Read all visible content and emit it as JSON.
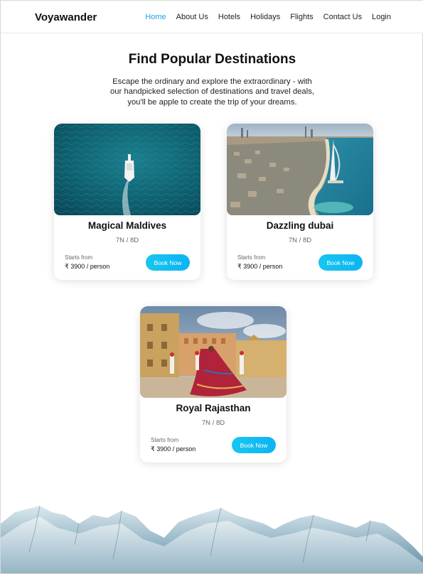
{
  "nav": {
    "brand": "Voyawander",
    "links": [
      {
        "label": "Home",
        "active": true
      },
      {
        "label": "About Us"
      },
      {
        "label": "Hotels"
      },
      {
        "label": "Holidays"
      },
      {
        "label": "Flights"
      },
      {
        "label": "Contact Us"
      },
      {
        "label": "Login"
      }
    ]
  },
  "hero": {
    "title": "Find Popular Destinations",
    "subtitle_lines": [
      "Escape the ordinary and explore the extraordinary - with",
      "our handpicked selection of destinations and travel deals,",
      "you'll be apple to create the trip of your dreams."
    ]
  },
  "cards": [
    {
      "name": "Magical Maldives",
      "duration": "7N / 8D",
      "from_label": "Starts from",
      "price": "₹ 3900 / person",
      "button": "Book Now",
      "image": "boat-on-sea-photo"
    },
    {
      "name": "Dazzling dubai",
      "duration": "7N / 8D",
      "from_label": "Starts from",
      "price": "₹ 3900 / person",
      "button": "Book Now",
      "image": "dubai-coastline-photo"
    },
    {
      "name": "Royal Rajasthan",
      "duration": "7N / 8D",
      "from_label": "Starts from",
      "price": "₹ 3900 / person",
      "button": "Book Now",
      "image": "rajasthan-dancer-photo"
    }
  ],
  "colors": {
    "accent": "#1aa3e8",
    "button": "#17c6f0"
  }
}
